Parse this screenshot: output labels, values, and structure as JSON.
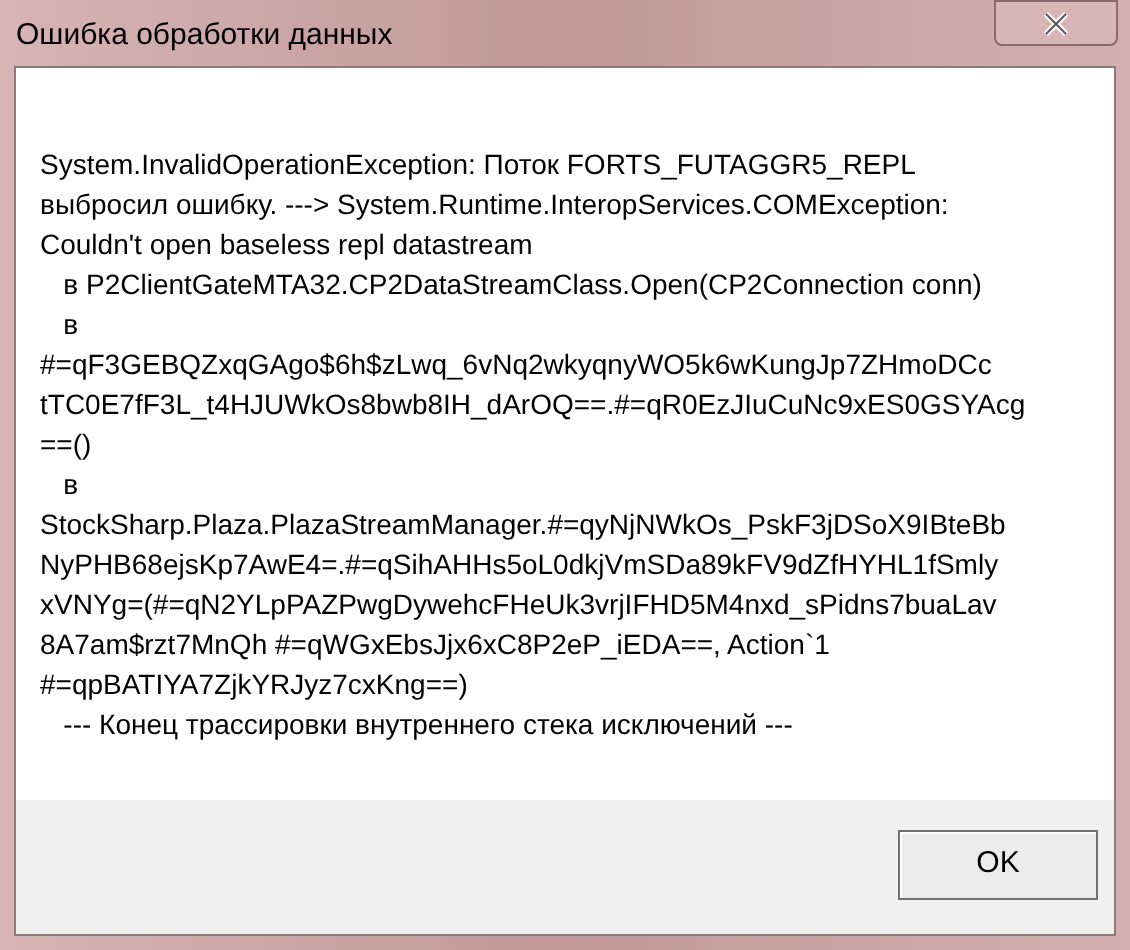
{
  "window": {
    "title": "Ошибка обработки данных"
  },
  "message_lines": [
    "System.InvalidOperationException: Поток FORTS_FUTAGGR5_REPL",
    "выбросил ошибку. ---> System.Runtime.InteropServices.COMException:",
    "Couldn't open baseless repl datastream",
    "   в P2ClientGateMTA32.CP2DataStreamClass.Open(CP2Connection conn)",
    "   в",
    "#=qF3GEBQZxqGAgo$6h$zLwq_6vNq2wkyqnyWO5k6wKungJp7ZHmoDCc",
    "tTC0E7fF3L_t4HJUWkOs8bwb8IH_dArOQ==.#=qR0EzJIuCuNc9xES0GSYAcg",
    "==()",
    "   в",
    "StockSharp.Plaza.PlazaStreamManager.#=qyNjNWkOs_PskF3jDSoX9IBteBb",
    "NyPHB68ejsKp7AwE4=.#=qSihAHHs5oL0dkjVmSDa89kFV9dZfHYHL1fSmly",
    "xVNYg=(#=qN2YLpPAZPwgDywehcFHeUk3vrjIFHD5M4nxd_sPidns7buaLav",
    "8A7am$rzt7MnQh #=qWGxEbsJjx6xC8P2eP_iEDA==, Action`1",
    "#=qpBATIYA7ZjkYRJyz7cxKng==)",
    "   --- Конец трассировки внутреннего стека исключений ---"
  ],
  "buttons": [
    "OK"
  ]
}
